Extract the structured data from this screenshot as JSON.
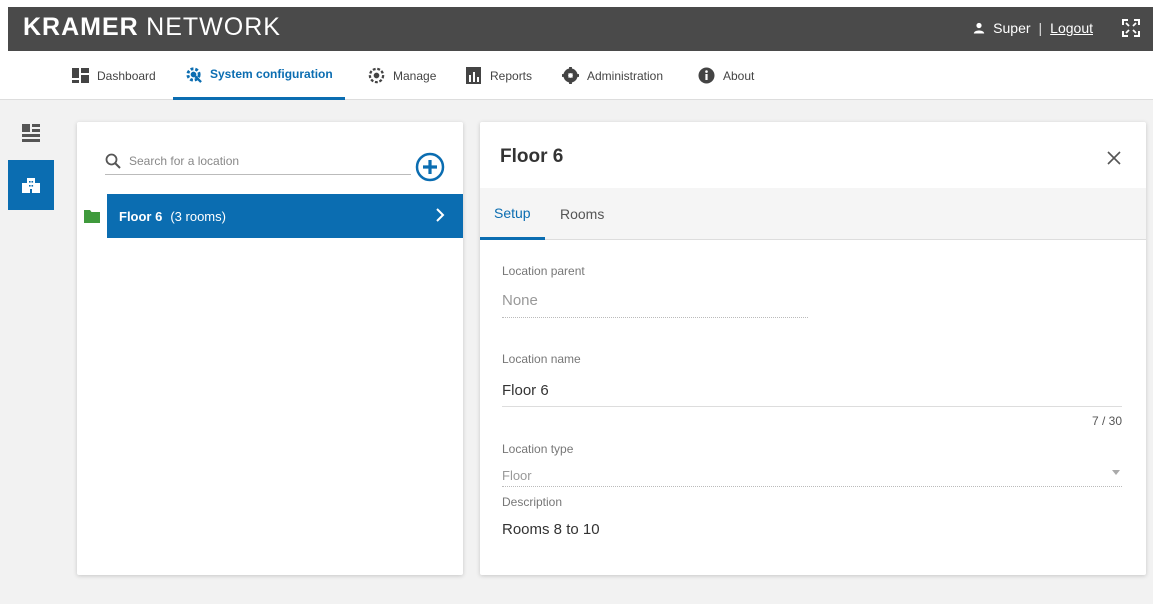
{
  "header": {
    "brand_bold": "KRAMER",
    "brand_light": "NETWORK",
    "user": "Super",
    "separator": "|",
    "logout": "Logout"
  },
  "nav": {
    "items": [
      {
        "label": "Dashboard",
        "icon": "dashboard-icon"
      },
      {
        "label": "System configuration",
        "icon": "system-config-icon",
        "active": true
      },
      {
        "label": "Manage",
        "icon": "manage-icon"
      },
      {
        "label": "Reports",
        "icon": "reports-icon"
      },
      {
        "label": "Administration",
        "icon": "administration-icon"
      },
      {
        "label": "About",
        "icon": "info-icon"
      }
    ]
  },
  "rail": {
    "items": [
      {
        "icon": "rooms-icon",
        "active": false
      },
      {
        "icon": "building-icon",
        "active": true
      }
    ]
  },
  "left_panel": {
    "search_placeholder": "Search for a location",
    "locations": [
      {
        "name": "Floor 6",
        "detail": "(3 rooms)",
        "selected": true
      }
    ]
  },
  "right_panel": {
    "title": "Floor 6",
    "tabs": [
      {
        "label": "Setup",
        "active": true
      },
      {
        "label": "Rooms",
        "active": false
      }
    ],
    "fields": {
      "parent_label": "Location parent",
      "parent_value": "None",
      "name_label": "Location name",
      "name_value": "Floor 6",
      "name_counter": "7 / 30",
      "type_label": "Location type",
      "type_value": "Floor",
      "description_label": "Description",
      "description_value": "Rooms 8 to 10"
    }
  },
  "colors": {
    "accent": "#0b6db1",
    "header_bg": "#4a4a4a",
    "folder": "#3f9a3c"
  }
}
